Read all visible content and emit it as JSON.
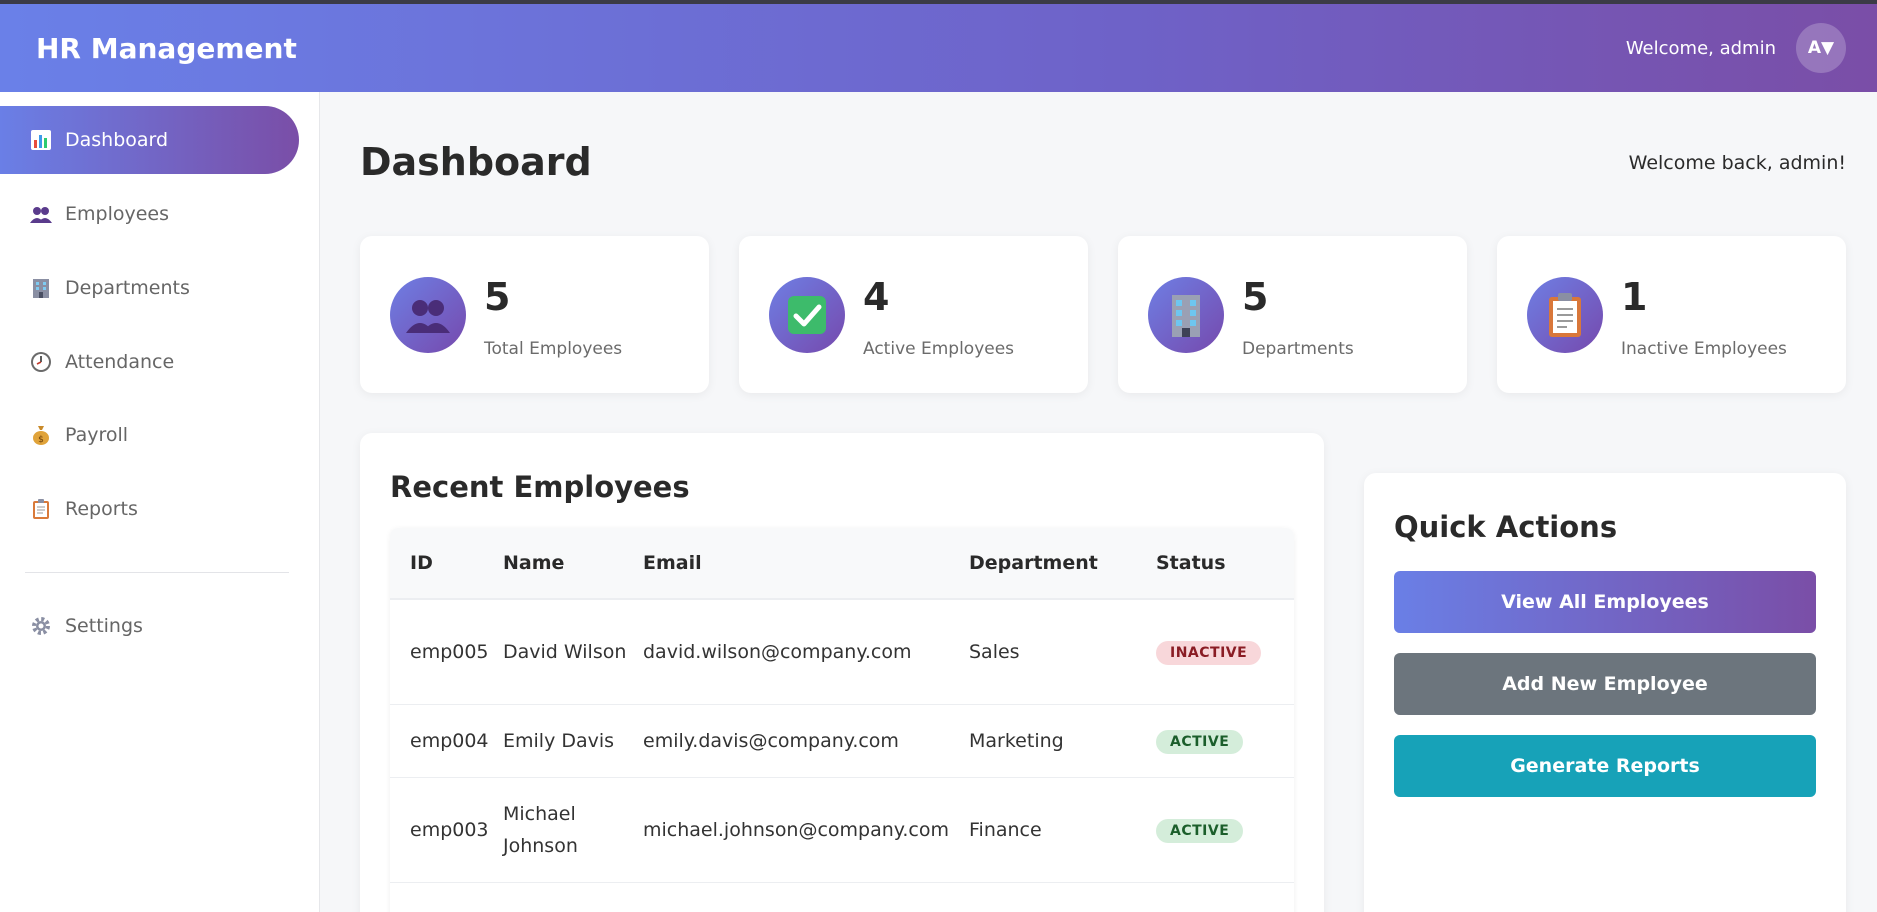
{
  "header": {
    "brand": "HR Management",
    "welcome": "Welcome, admin",
    "avatar": "A▼"
  },
  "sidebar": {
    "items": [
      {
        "label": "Dashboard",
        "icon": "bar-chart-icon",
        "active": true
      },
      {
        "label": "Employees",
        "icon": "people-icon"
      },
      {
        "label": "Departments",
        "icon": "building-icon"
      },
      {
        "label": "Attendance",
        "icon": "clock-icon"
      },
      {
        "label": "Payroll",
        "icon": "money-bag-icon"
      },
      {
        "label": "Reports",
        "icon": "clipboard-icon"
      }
    ],
    "settings": {
      "label": "Settings",
      "icon": "gear-icon"
    }
  },
  "page": {
    "title": "Dashboard",
    "welcome": "Welcome back, admin!"
  },
  "stats": [
    {
      "value": "5",
      "label": "Total Employees",
      "icon": "people-icon"
    },
    {
      "value": "4",
      "label": "Active Employees",
      "icon": "check-icon"
    },
    {
      "value": "5",
      "label": "Departments",
      "icon": "building-icon"
    },
    {
      "value": "1",
      "label": "Inactive Employees",
      "icon": "clipboard-icon"
    }
  ],
  "recent": {
    "title": "Recent Employees",
    "columns": [
      "ID",
      "Name",
      "Email",
      "Department",
      "Status"
    ],
    "rows": [
      {
        "id": "emp005",
        "name": "David Wilson",
        "email": "david.wilson@company.com",
        "department": "Sales",
        "status": "INACTIVE"
      },
      {
        "id": "emp004",
        "name": "Emily Davis",
        "email": "emily.davis@company.com",
        "department": "Marketing",
        "status": "ACTIVE"
      },
      {
        "id": "emp003",
        "name": "Michael Johnson",
        "email": "michael.johnson@company.com",
        "department": "Finance",
        "status": "ACTIVE"
      }
    ]
  },
  "quick_actions": {
    "title": "Quick Actions",
    "buttons": [
      {
        "label": "View All Employees"
      },
      {
        "label": "Add New Employee"
      },
      {
        "label": "Generate Reports"
      }
    ]
  },
  "colors": {
    "accent_start": "#6a80e8",
    "accent_end": "#7a4ea7",
    "secondary": "#6c757d",
    "info": "#17a2b8"
  }
}
